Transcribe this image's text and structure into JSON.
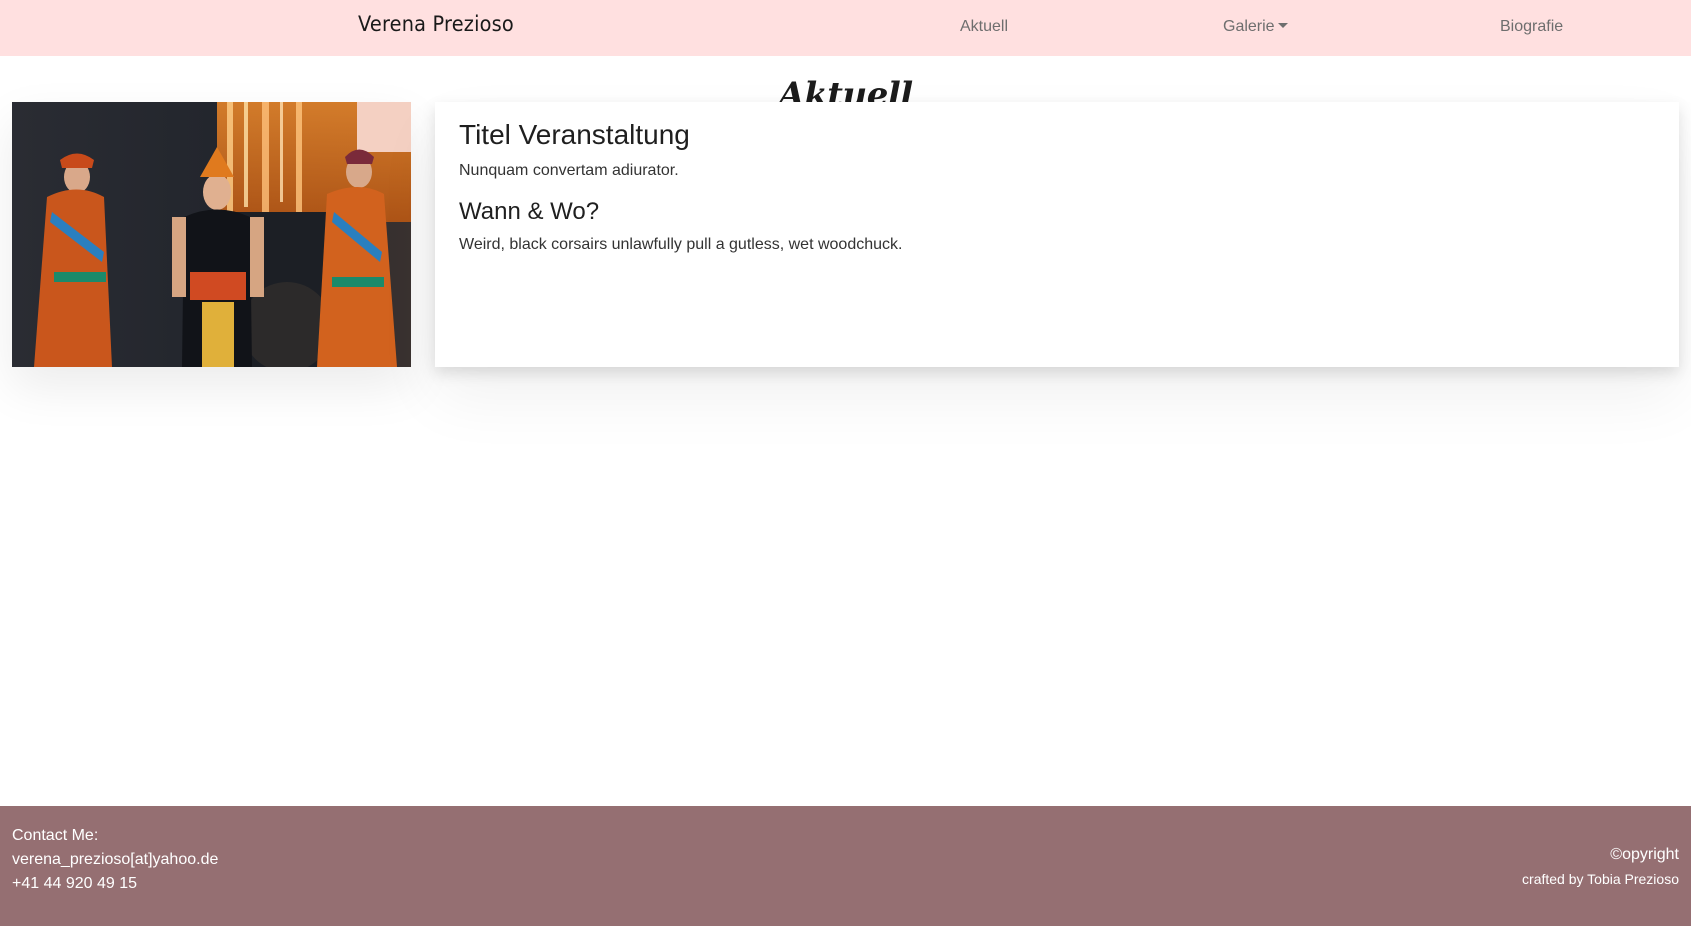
{
  "nav": {
    "brand": "Verena Prezioso",
    "links": [
      {
        "label": "Aktuell"
      },
      {
        "label": "Galerie"
      },
      {
        "label": "Biografie"
      }
    ]
  },
  "page": {
    "heading": "Aktuell"
  },
  "event": {
    "title": "Titel Veranstaltung",
    "description": "Nunquam convertam adiurator.",
    "when_where_heading": "Wann & Wo?",
    "when_where_text": "Weird, black corsairs unlawfully pull a gutless, wet woodchuck."
  },
  "footer": {
    "contact_label": "Contact Me:",
    "email": "verena_prezioso[at]yahoo.de",
    "phone": "+41 44 920 49 15",
    "copyright": "©opyright",
    "crafted_by": "crafted by Tobia Prezioso"
  },
  "colors": {
    "navbar_bg": "#ffe0e0",
    "footer_bg": "#956f72"
  }
}
